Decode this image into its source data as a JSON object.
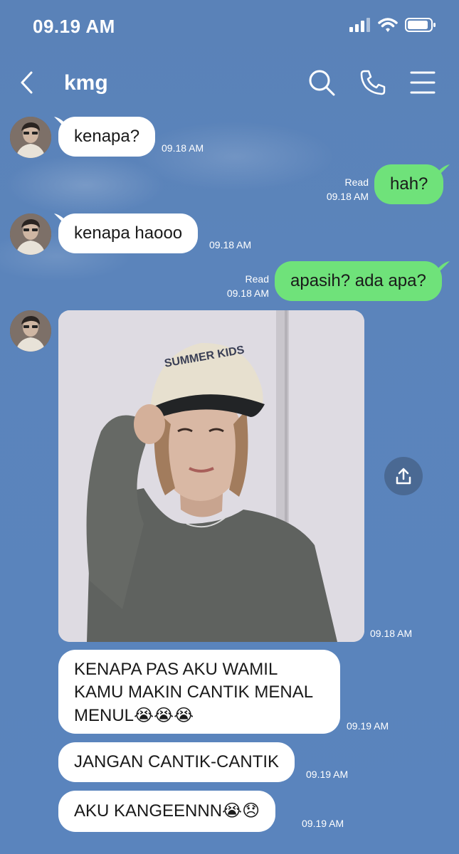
{
  "status_bar": {
    "time": "09.19 AM"
  },
  "header": {
    "title": "kmg"
  },
  "messages": {
    "m1": {
      "text": "kenapa?",
      "time": "09.18 AM"
    },
    "m2": {
      "text": "hah?",
      "read": "Read",
      "time": "09.18 AM"
    },
    "m3": {
      "text": "kenapa haooo",
      "time": "09.18 AM"
    },
    "m4": {
      "text": "apasih? ada apa?",
      "read": "Read",
      "time": "09.18 AM"
    },
    "m5": {
      "time": "09.18 AM",
      "image_text": "SUMMER KIDS"
    },
    "m6": {
      "line1": "KENAPA PAS AKU WAMIL",
      "line2": "KAMU MAKIN CANTIK MENAL",
      "line3": "MENUL",
      "emoji": "😭😭😭",
      "time": "09.19 AM"
    },
    "m7": {
      "text": "JANGAN CANTIK-CANTIK",
      "time": "09.19 AM"
    },
    "m8": {
      "text": "AKU KANGEENNN",
      "emoji": "😭😞",
      "time": "09.19 AM"
    }
  },
  "icons": {
    "back": "chevron-left-icon",
    "search": "search-icon",
    "call": "phone-icon",
    "menu": "menu-icon",
    "share": "share-icon"
  },
  "colors": {
    "background": "#5a84bd",
    "incoming": "#ffffff",
    "outgoing": "#6fe27a"
  }
}
